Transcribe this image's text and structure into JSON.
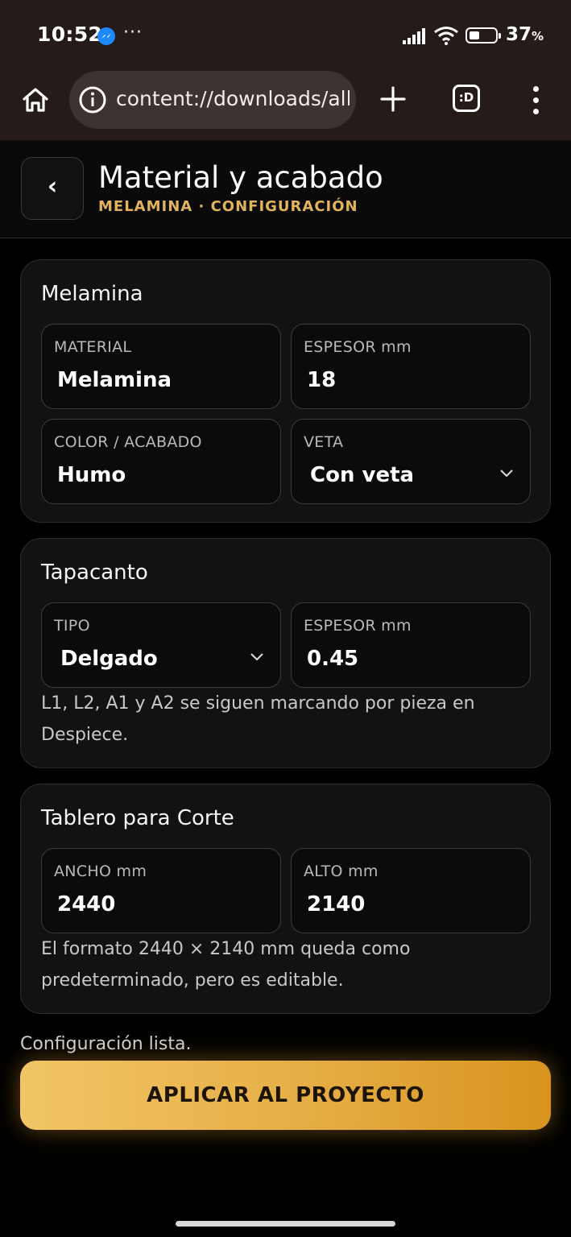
{
  "status_bar": {
    "time": "10:52",
    "more": "···",
    "battery_pct": "37",
    "battery_unit": "%"
  },
  "browser": {
    "url": "content://downloads/all_",
    "tabs_label": ":D",
    "icons": [
      "home-icon",
      "info-icon",
      "plus-icon",
      "tabs-icon",
      "menu-icon"
    ]
  },
  "header": {
    "back": "‹",
    "title": "Material y acabado",
    "subtitle": "MELAMINA · CONFIGURACIÓN"
  },
  "melamina": {
    "title": "Melamina",
    "material_label": "MATERIAL",
    "material_value": "Melamina",
    "espesor_label": "ESPESOR mm",
    "espesor_value": "18",
    "color_label": "COLOR / ACABADO",
    "color_value": "Humo",
    "veta_label": "VETA",
    "veta_value": "Con veta"
  },
  "tapacanto": {
    "title": "Tapacanto",
    "tipo_label": "TIPO",
    "tipo_value": "Delgado",
    "espesor_label": "ESPESOR mm",
    "espesor_value": "0.45",
    "note": "L1, L2, A1 y A2 se siguen marcando por pieza en Despiece."
  },
  "tablero": {
    "title": "Tablero para Corte",
    "ancho_label": "ANCHO mm",
    "ancho_value": "2440",
    "alto_label": "ALTO mm",
    "alto_value": "2140",
    "note": "El formato 2440 × 2140 mm queda como predeterminado, pero es editable."
  },
  "footer": {
    "status": "Configuración lista.",
    "apply_label": "APLICAR AL PROYECTO"
  },
  "colors": {
    "accent": "#e3b35c",
    "button_start": "#f1c565",
    "button_end": "#d8931e",
    "background": "#000000",
    "card": "#121212"
  }
}
